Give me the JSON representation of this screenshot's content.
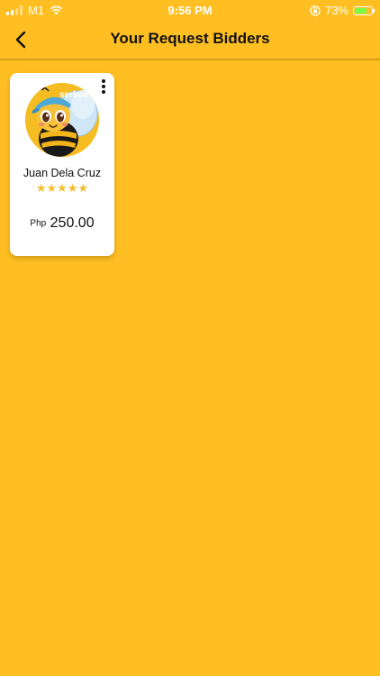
{
  "status_bar": {
    "carrier": "M1",
    "time": "9:56 PM",
    "battery_percent": "73%",
    "battery_level": 0.73,
    "icons": [
      "signal-icon",
      "wifi-icon",
      "orientation-lock-icon",
      "battery-charging-icon"
    ]
  },
  "header": {
    "title": "Your Request Bidders",
    "back_icon": "chevron-left-icon"
  },
  "bidders": [
    {
      "name": "Juan Dela Cruz",
      "rating": 5,
      "stars": "★★★★★",
      "currency": "Php",
      "price": "250.00",
      "avatar_watermark": "serbee"
    }
  ],
  "colors": {
    "background": "#FFBF22",
    "card": "#FFFFFF",
    "star": "#F2BE2C",
    "text": "#111111"
  }
}
